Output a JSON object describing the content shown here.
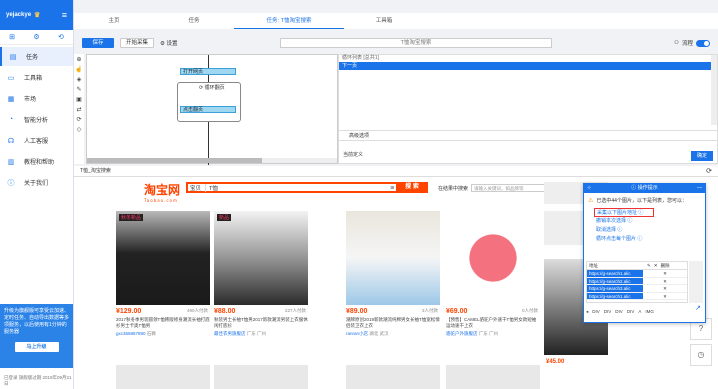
{
  "sidebar": {
    "username": "yejackye",
    "items": [
      {
        "label": "任务",
        "icon": "file-icon"
      },
      {
        "label": "工具箱",
        "icon": "toolbox-icon"
      },
      {
        "label": "市场",
        "icon": "market-icon"
      },
      {
        "label": "智能分析",
        "icon": "analysis-icon"
      },
      {
        "label": "人工客服",
        "icon": "headset-icon"
      },
      {
        "label": "教程和帮助",
        "icon": "book-icon"
      },
      {
        "label": "关于我们",
        "icon": "info-icon"
      }
    ],
    "promo_text": "升级为旗舰版可享受云加速、定时任务、自动导出数据等多项服务，以后使用有1分钟的服务器",
    "promo_button": "马上升级",
    "footer": "已登录 旗舰版过期 2019年09月21日"
  },
  "tabs": [
    "主页",
    "任务",
    "任务: T恤淘宝搜索",
    "工具箱"
  ],
  "toolbar": {
    "save": "保存",
    "start": "开始采集",
    "settings": "设置",
    "task_name": "T恤淘宝搜索",
    "flow_label": "流程"
  },
  "flow": {
    "node_open": "打开网页",
    "loop": "循环翻页",
    "node_click": "点击翻页"
  },
  "right_panel": {
    "header": "循环列表 [总共1]",
    "row": "下一页",
    "advanced": "高级选项",
    "current": "当前定义",
    "ok": "确定"
  },
  "browser": {
    "tab_title": "T恤_淘宝搜索"
  },
  "taobao": {
    "logo": "淘宝网",
    "logo_sub": "Taobao.com",
    "search_category": "宝贝",
    "query": "T恤",
    "search_button": "搜 索",
    "shop_search_label": "在结果中搜索",
    "shop_search_placeholder": "请输入关键词，如品牌等",
    "shop_search_button": "确定",
    "products": [
      {
        "price": "¥129.00",
        "sold": "490人付款",
        "desc": "2017秋冬季男装圆领T恤韩版修身潮流长袖打底衫男士卡奥T恤男",
        "shop": "gxc366887890",
        "loc": "石狮",
        "badge": "秋冬新品"
      },
      {
        "price": "¥88.00",
        "sold": "227人付款",
        "desc": "秋装男士长袖T恤男2017新款潮流男装上衣服休闲打底衫",
        "shop": "最佳衣男旗舰店",
        "loc": "广东 广州",
        "badge": "新品"
      },
      {
        "price": "¥89.00",
        "sold": "3人付款",
        "desc": "潮牌原创2019新款潮流纯棉男女长袖T恤宽松情侣装卫衣上衣",
        "shop": "ranran小店",
        "loc": "湖北 武汉",
        "badge": ""
      },
      {
        "price": "¥69.00",
        "sold": "0人付款",
        "desc": "【预售】CAMEL骆驼户外速干T恤男女款短袖运动速干上衣",
        "shop": "骆驼户外旗舰店",
        "loc": "广东 广州",
        "badge": ""
      }
    ],
    "right_price": "¥45.00"
  },
  "tips": {
    "title": "操作提示",
    "message": "已选中44个图片，以下是列表，您可以：",
    "options": [
      "采集以下图片地址",
      "撤销本次选择",
      "取消选择",
      "循环点击每个图片"
    ],
    "table_header_col": "地址",
    "table_delete": "删除",
    "urls": [
      "https://g-search1.alic",
      "https://g-search2.alic",
      "https://g-search3.alic",
      "https://g-search1.alic",
      "https://g-search1.alic",
      "https://g-search1.alic"
    ],
    "path": [
      "DIV",
      "DIV",
      "DIV",
      "DIV",
      "A",
      "IMG"
    ]
  }
}
